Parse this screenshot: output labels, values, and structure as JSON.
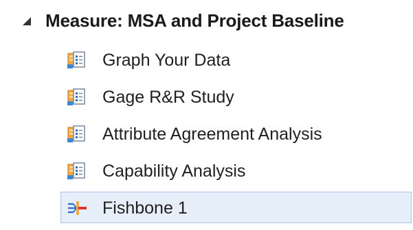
{
  "tree": {
    "group": {
      "title": "Measure:  MSA and Project Baseline",
      "expander_icon": "expanded-triangle-icon"
    },
    "items": [
      {
        "label": "Graph Your Data",
        "icon": "report-document-icon"
      },
      {
        "label": "Gage R&R Study",
        "icon": "report-document-icon"
      },
      {
        "label": "Attribute Agreement Analysis",
        "icon": "report-document-icon"
      },
      {
        "label": "Capability Analysis",
        "icon": "report-document-icon"
      },
      {
        "label": "Fishbone 1",
        "icon": "fishbone-diagram-icon",
        "selected": true
      }
    ]
  },
  "colors": {
    "selection_background": "#e6eef9",
    "selection_border": "#a9c4ea",
    "icon_orange": "#f0a64a",
    "icon_blue": "#2f6fc8",
    "icon_red": "#e0342c"
  }
}
